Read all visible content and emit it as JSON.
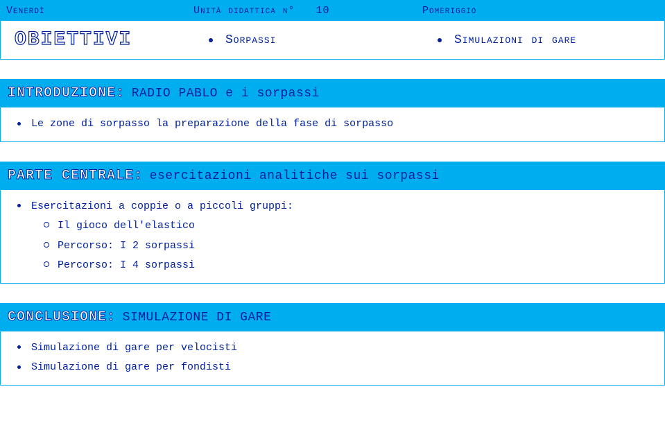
{
  "header": {
    "day": "Venerdì",
    "unit_label": "Unità didattica n°",
    "unit_number": "10",
    "session": "Pomeriggio",
    "objectives_label": "OBIETTIVI",
    "objectives": [
      "Sorpassi",
      "Simulazioni di gare"
    ]
  },
  "sections": [
    {
      "prefix": "INTRODUZIONE:",
      "title": "RADIO PABLO e i sorpassi",
      "items": [
        {
          "text": "Le zone di sorpasso la preparazione della fase di sorpasso"
        }
      ]
    },
    {
      "prefix": "PARTE CENTRALE:",
      "title": "esercitazioni analitiche sui sorpassi",
      "items": [
        {
          "text": "Esercitazioni a coppie o a piccoli gruppi:",
          "sub": [
            "Il gioco dell'elastico",
            "Percorso: I 2 sorpassi",
            "Percorso: I 4 sorpassi"
          ]
        }
      ]
    },
    {
      "prefix": "CONCLUSIONE:",
      "title": "SIMULAZIONE DI GARE",
      "items": [
        {
          "text": "Simulazione di gare per velocisti"
        },
        {
          "text": "Simulazione di gare per fondisti"
        }
      ]
    }
  ]
}
